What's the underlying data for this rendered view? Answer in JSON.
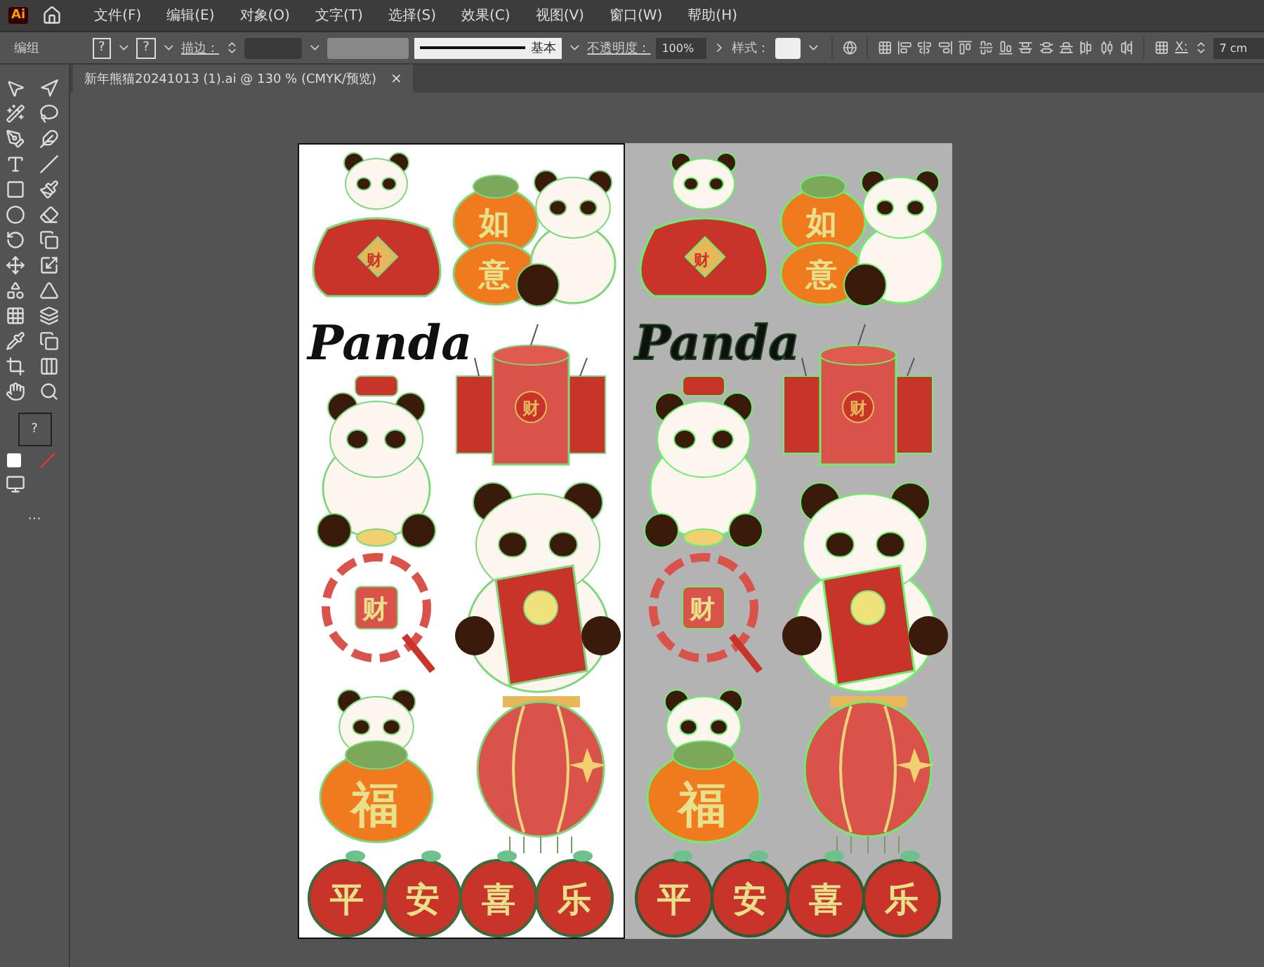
{
  "app": {
    "logo": "Ai"
  },
  "menu": [
    "文件(F)",
    "编辑(E)",
    "对象(O)",
    "文字(T)",
    "选择(S)",
    "效果(C)",
    "视图(V)",
    "窗口(W)",
    "帮助(H)"
  ],
  "control_bar": {
    "selection": "编组",
    "fill": "?",
    "stroke": "?",
    "stroke_label": "描边：",
    "brush": "基本",
    "opacity_label": "不透明度：",
    "opacity": "100%",
    "style_label": "样式：",
    "x_label": "X:",
    "x_value": "7 cm"
  },
  "document_tab": {
    "title": "新年熊猫20241013  (1).ai @ 130 % (CMYK/预览)",
    "close": "×"
  },
  "tools": {
    "fill": "?",
    "more": "..."
  },
  "artboards": [
    {
      "selected": false,
      "title": "Panda",
      "bag_char": "财",
      "ruyi": [
        "如",
        "意"
      ],
      "firecracker_char": "财",
      "knot_char": "财",
      "fu_char": "福",
      "apples": [
        "平",
        "安",
        "喜",
        "乐"
      ]
    },
    {
      "selected": true,
      "title": "Panda",
      "bag_char": "财",
      "ruyi": [
        "如",
        "意"
      ],
      "firecracker_char": "财",
      "knot_char": "财",
      "fu_char": "福",
      "apples": [
        "平",
        "安",
        "喜",
        "乐"
      ]
    }
  ]
}
